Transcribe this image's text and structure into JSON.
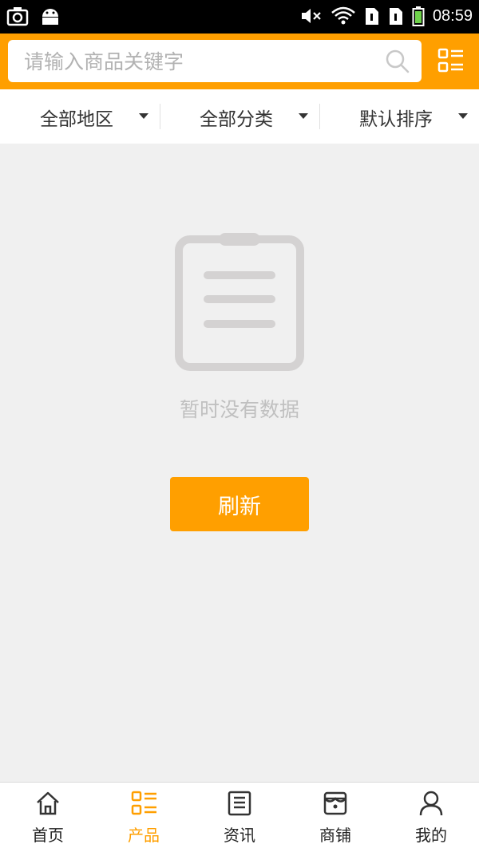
{
  "status_bar": {
    "time": "08:59",
    "icons": [
      "screenshot-icon",
      "android-icon",
      "mute-icon",
      "wifi-icon",
      "sim1-icon",
      "sim2-icon",
      "battery-icon"
    ]
  },
  "search": {
    "placeholder": "请输入商品关键字",
    "value": ""
  },
  "filters": [
    {
      "label": "全部地区"
    },
    {
      "label": "全部分类"
    },
    {
      "label": "默认排序"
    }
  ],
  "empty_state": {
    "message": "暂时没有数据",
    "refresh_label": "刷新"
  },
  "tabs": [
    {
      "label": "首页",
      "icon": "home-icon",
      "active": false
    },
    {
      "label": "产品",
      "icon": "product-list-icon",
      "active": true
    },
    {
      "label": "资讯",
      "icon": "news-icon",
      "active": false
    },
    {
      "label": "商铺",
      "icon": "store-icon",
      "active": false
    },
    {
      "label": "我的",
      "icon": "user-icon",
      "active": false
    }
  ],
  "colors": {
    "accent": "#ff9f00",
    "background": "#f0f0f0",
    "empty_icon": "#d4d2d2",
    "text": "#333333"
  }
}
